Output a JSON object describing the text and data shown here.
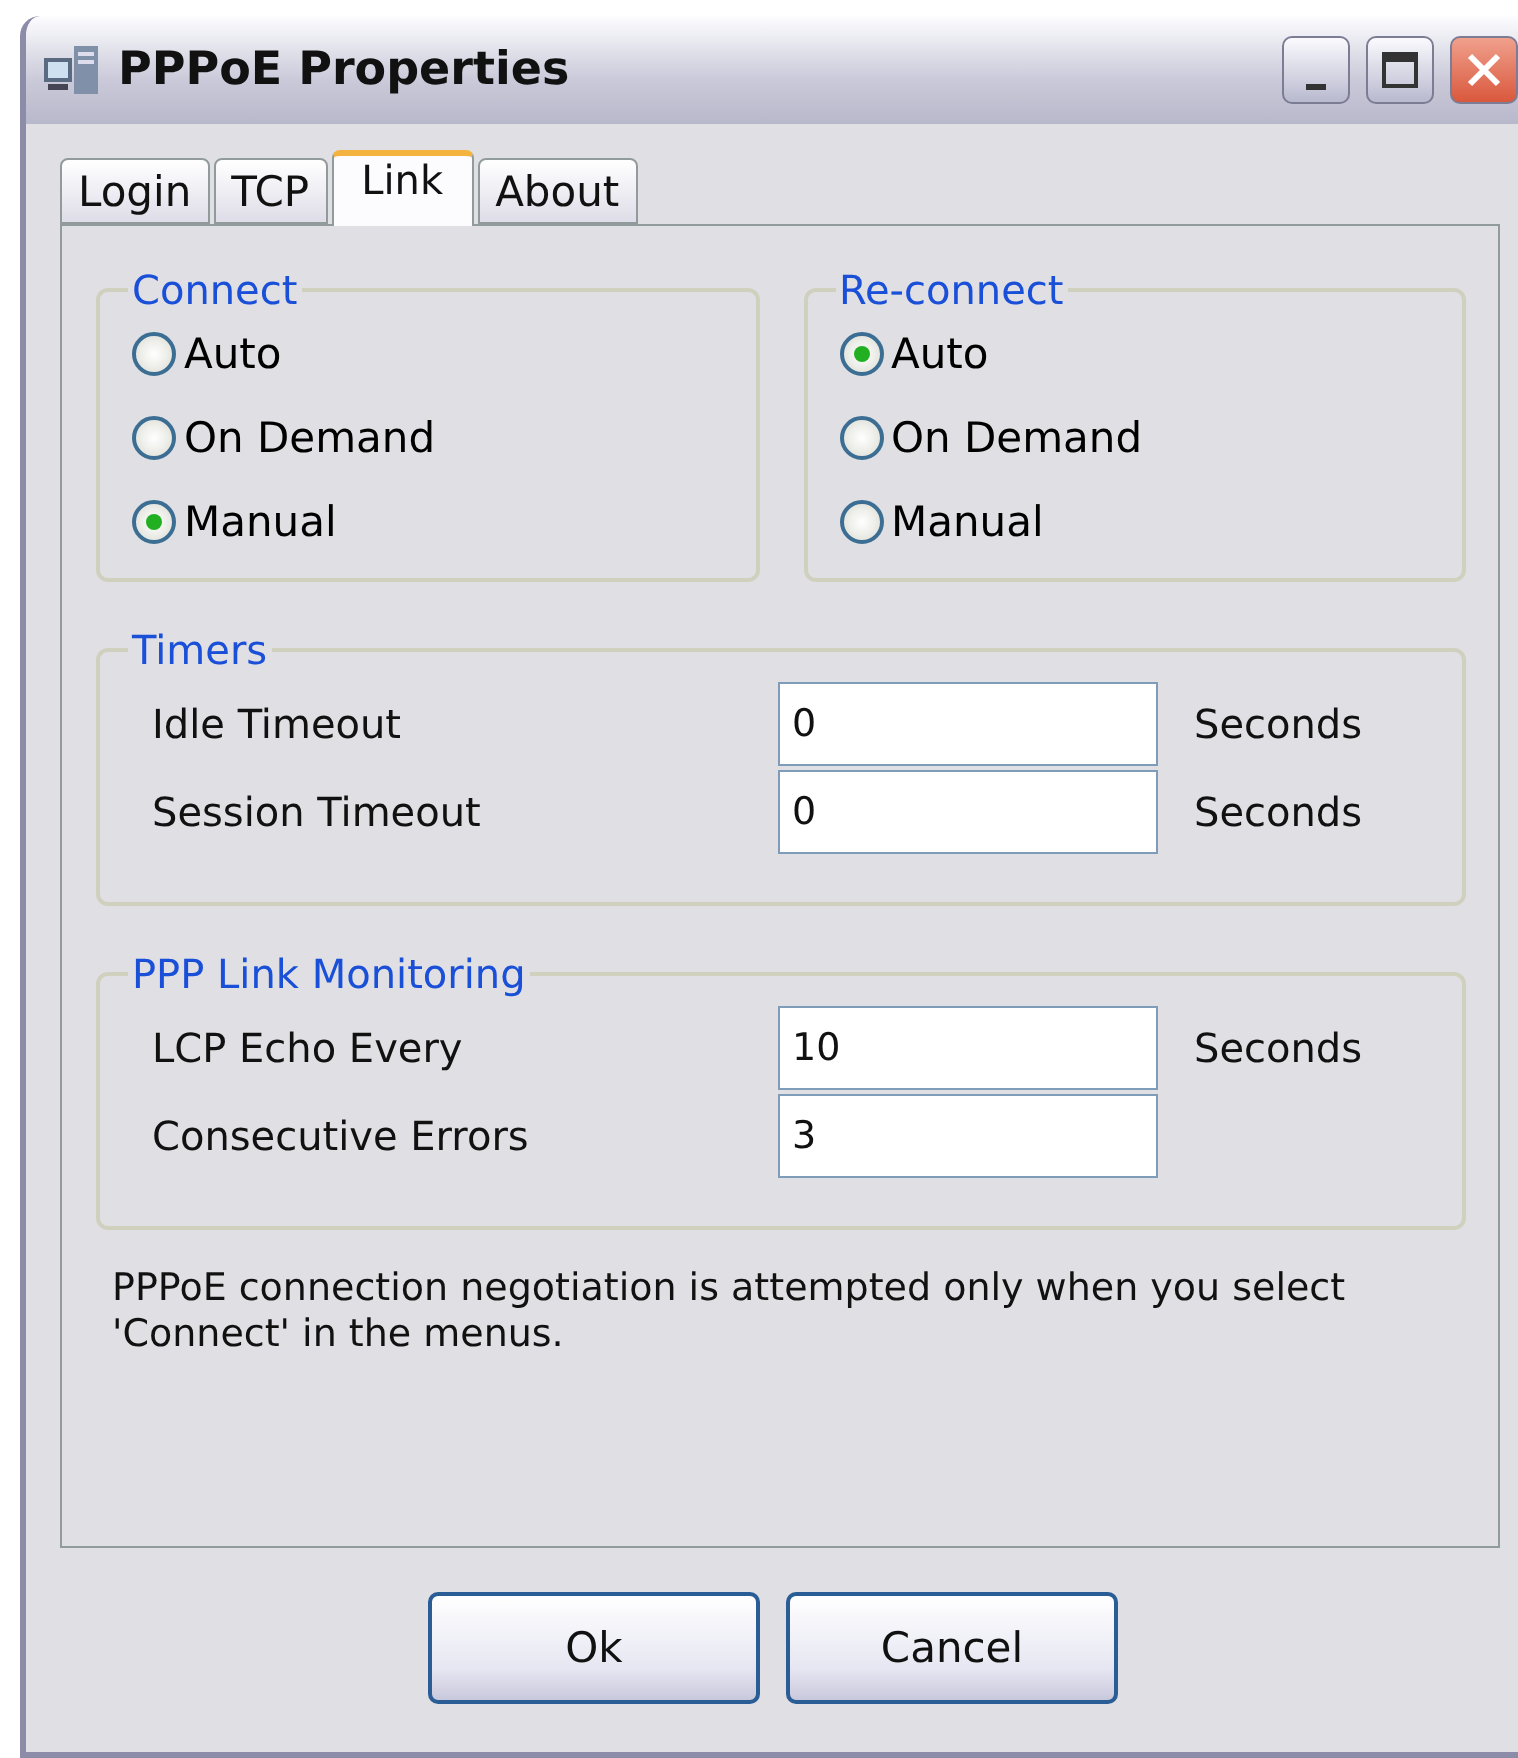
{
  "window": {
    "title": "PPPoE Properties"
  },
  "tabs": [
    {
      "label": "Login",
      "selected": false
    },
    {
      "label": "TCP",
      "selected": false
    },
    {
      "label": "Link",
      "selected": true
    },
    {
      "label": "About",
      "selected": false
    }
  ],
  "connect": {
    "title": "Connect",
    "options": [
      {
        "label": "Auto",
        "selected": false
      },
      {
        "label": "On Demand",
        "selected": false
      },
      {
        "label": "Manual",
        "selected": true
      }
    ]
  },
  "reconnect": {
    "title": "Re-connect",
    "options": [
      {
        "label": "Auto",
        "selected": true
      },
      {
        "label": "On Demand",
        "selected": false
      },
      {
        "label": "Manual",
        "selected": false
      }
    ]
  },
  "timers": {
    "title": "Timers",
    "fields": [
      {
        "label": "Idle Timeout",
        "value": "0",
        "unit": "Seconds"
      },
      {
        "label": "Session Timeout",
        "value": "0",
        "unit": "Seconds"
      }
    ]
  },
  "monitoring": {
    "title": "PPP Link Monitoring",
    "fields": [
      {
        "label": "LCP Echo Every",
        "value": "10",
        "unit": "Seconds"
      },
      {
        "label": "Consecutive Errors",
        "value": "3"
      }
    ]
  },
  "note": "PPPoE connection negotiation is attempted only when you select 'Connect' in the menus.",
  "buttons": [
    "Ok",
    "Cancel"
  ]
}
